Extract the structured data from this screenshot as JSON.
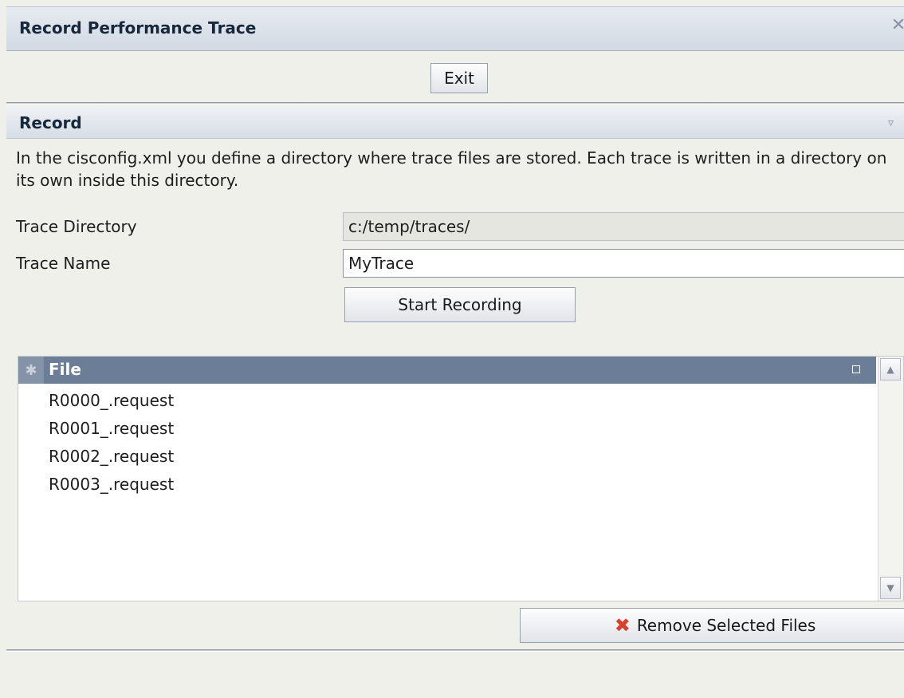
{
  "window": {
    "title": "Record Performance Trace",
    "close_glyph": "✕"
  },
  "toolbar": {
    "exit_label": "Exit"
  },
  "record_section": {
    "title": "Record",
    "collapse_glyph": "▿",
    "description": "In the cisconfig.xml you define a directory where trace files are stored. Each trace is written in a directory on its own inside this directory.",
    "trace_directory_label": "Trace Directory",
    "trace_directory_value": "c:/temp/traces/",
    "trace_name_label": "Trace Name",
    "trace_name_value": "MyTrace",
    "start_recording_label": "Start Recording"
  },
  "file_grid": {
    "select_all_glyph": "✱",
    "column_header": "File",
    "rows": [
      "R0000_.request",
      "R0001_.request",
      "R0002_.request",
      "R0003_.request"
    ],
    "scroll_up_glyph": "▲",
    "scroll_down_glyph": "▼"
  },
  "actions": {
    "remove_icon": "✖",
    "remove_label": "Remove Selected Files"
  },
  "icons": {
    "close": "close-icon",
    "collapse": "chevron-down-icon",
    "remove": "remove-x-icon"
  },
  "colors": {
    "grid_header": "#6c7d97",
    "remove_icon": "#d8412c"
  }
}
